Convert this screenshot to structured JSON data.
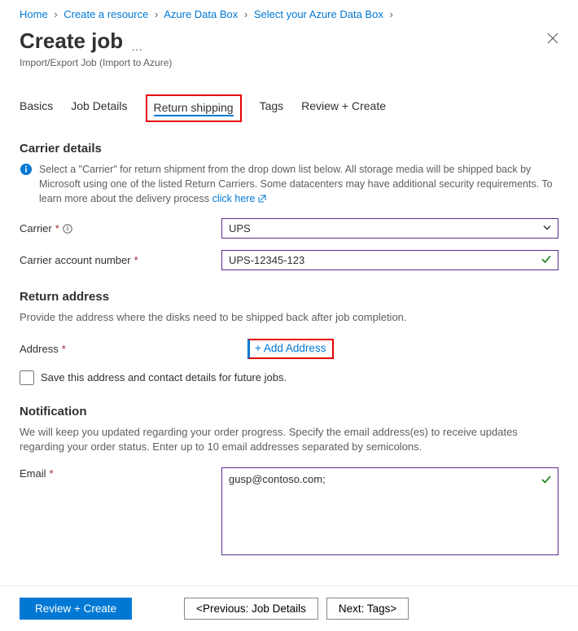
{
  "breadcrumb": [
    {
      "label": "Home"
    },
    {
      "label": "Create a resource"
    },
    {
      "label": "Azure Data Box"
    },
    {
      "label": "Select your Azure Data Box"
    }
  ],
  "title": "Create job",
  "subtitle": "Import/Export Job (Import to Azure)",
  "tabs": {
    "basics": "Basics",
    "job_details": "Job Details",
    "return_shipping": "Return shipping",
    "tags": "Tags",
    "review": "Review + Create"
  },
  "carrier_section": {
    "heading": "Carrier details",
    "info_text_1": "Select a \"Carrier\" for return shipment from the drop down list below. All storage media will be shipped back by Microsoft using one of the listed Return Carriers. Some datacenters may have additional security requirements. To learn more about the delivery process ",
    "info_link": "click here",
    "carrier_label": "Carrier",
    "carrier_value": "UPS",
    "account_label": "Carrier account number",
    "account_value": "UPS-12345-123"
  },
  "return_section": {
    "heading": "Return address",
    "sub": "Provide the address where the disks need to be shipped back after job completion.",
    "address_label": "Address",
    "add_address": "+ Add Address",
    "save_label": "Save this address and contact details for future jobs."
  },
  "notification_section": {
    "heading": "Notification",
    "sub": "We will keep you updated regarding your order progress. Specify the email address(es) to receive updates regarding your order status. Enter up to 10 email addresses separated by semicolons.",
    "email_label": "Email",
    "email_value": "gusp@contoso.com;"
  },
  "footer": {
    "review": "Review + Create",
    "prev": "<Previous: Job Details",
    "next": "Next: Tags>"
  }
}
